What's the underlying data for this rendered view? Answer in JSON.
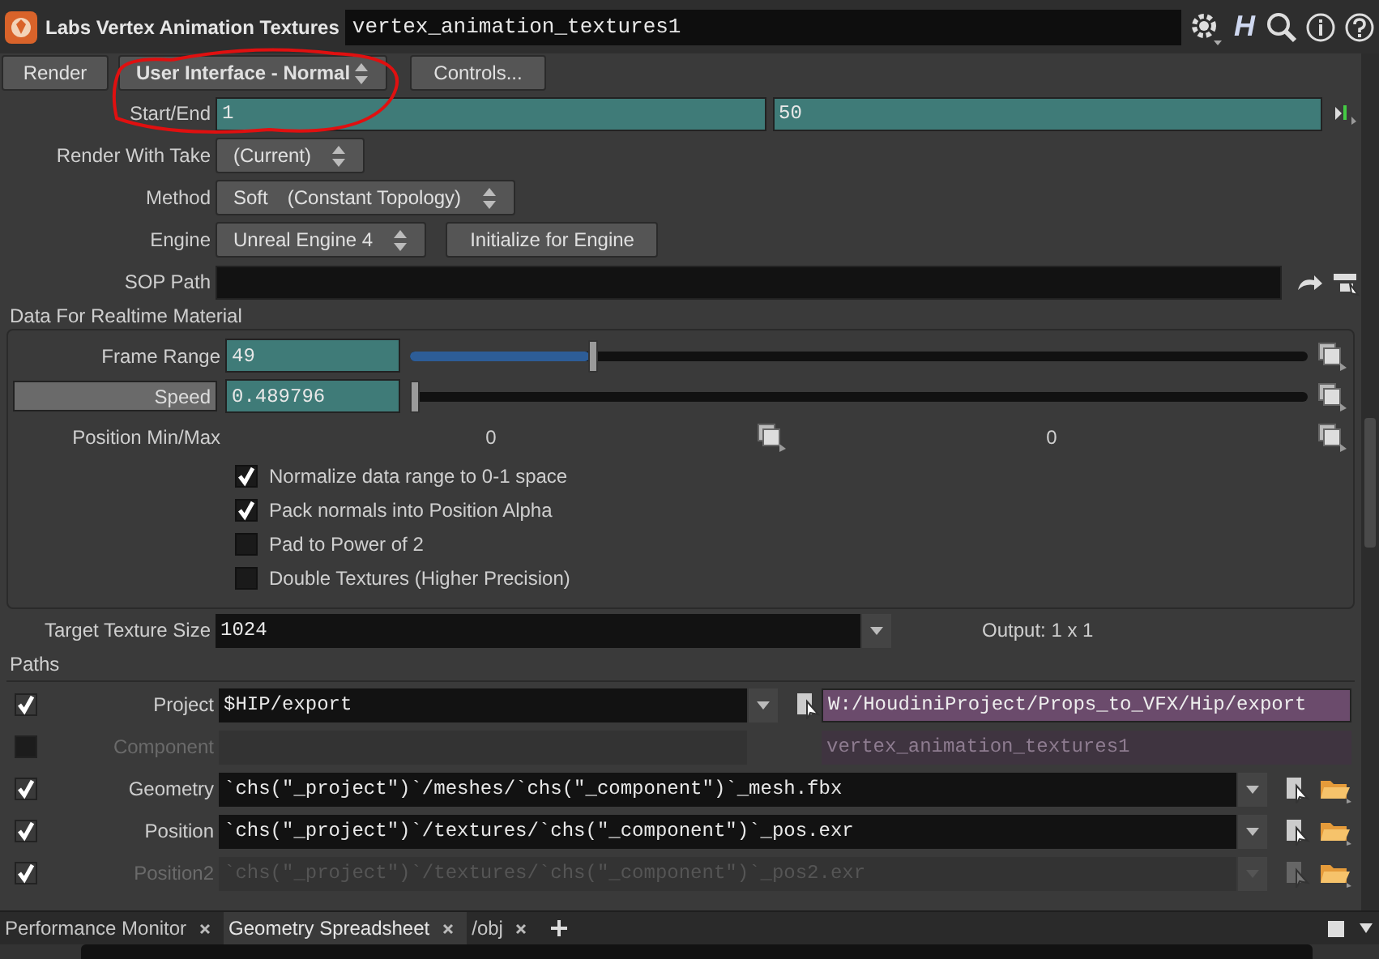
{
  "header": {
    "node_type": "Labs Vertex Animation Textures",
    "node_name": "vertex_animation_textures1",
    "logo_letter": "H"
  },
  "toolbar": {
    "render_button": "Render",
    "ui_menu": "User Interface - Normal",
    "controls_button": "Controls..."
  },
  "parameters": [
    {
      "kind": "range",
      "label": "Start/End",
      "values": [
        "1",
        "50"
      ]
    },
    {
      "kind": "menu",
      "label": "Render With Take",
      "value": "(Current)"
    },
    {
      "kind": "menu",
      "label": "Method",
      "value": "Soft",
      "detail": "(Constant Topology)"
    },
    {
      "kind": "menu",
      "label": "Engine",
      "value": "Unreal Engine 4",
      "button": "Initialize for Engine"
    },
    {
      "kind": "path",
      "label": "SOP Path"
    }
  ],
  "realtime_material": {
    "title": "Data For Realtime Material",
    "sliders": [
      {
        "label": "Frame Range",
        "value": "49",
        "level": 0.2,
        "label_button": false
      },
      {
        "label": "Speed",
        "value": "0.489796",
        "level": 0,
        "label_button": true
      }
    ],
    "min_max": {
      "label": "Position Min/Max",
      "values": [
        "0",
        "0"
      ]
    },
    "toggles": [
      {
        "label": "Normalize data range to 0-1 space",
        "checked": true
      },
      {
        "label": "Pack normals into Position Alpha",
        "checked": true
      },
      {
        "label": "Pad to Power of 2",
        "checked": false
      },
      {
        "label": "Double Textures (Higher Precision)",
        "checked": false
      }
    ]
  },
  "target_texture_size": {
    "label": "Target Texture Size",
    "value": "1024",
    "output": "Output: 1 x 1"
  },
  "paths": {
    "title": "Paths",
    "rows": [
      {
        "kind": "string",
        "label": "Project",
        "checked": true,
        "disabled": false,
        "value": "$HIP/export",
        "resolved": "W:/HoudiniProject/Props_to_VFX/Hip/export"
      },
      {
        "kind": "string",
        "label": "Component",
        "checked": false,
        "disabled": true,
        "resolved": "vertex_animation_textures1"
      },
      {
        "kind": "file",
        "label": "Geometry",
        "checked": true,
        "disabled": false,
        "value": "`chs(\"_project\")`/meshes/`chs(\"_component\")`_mesh.fbx"
      },
      {
        "kind": "file",
        "label": "Position",
        "checked": true,
        "disabled": false,
        "value": "`chs(\"_project\")`/textures/`chs(\"_component\")`_pos.exr"
      },
      {
        "kind": "file",
        "label": "Position2",
        "checked": true,
        "disabled": true,
        "value": "`chs(\"_project\")`/textures/`chs(\"_component\")`_pos2.exr"
      }
    ]
  },
  "tabs": [
    {
      "label": "Performance Monitor",
      "selected": false
    },
    {
      "label": "Geometry Spreadsheet",
      "selected": true
    },
    {
      "label": "/obj",
      "selected": false
    }
  ]
}
